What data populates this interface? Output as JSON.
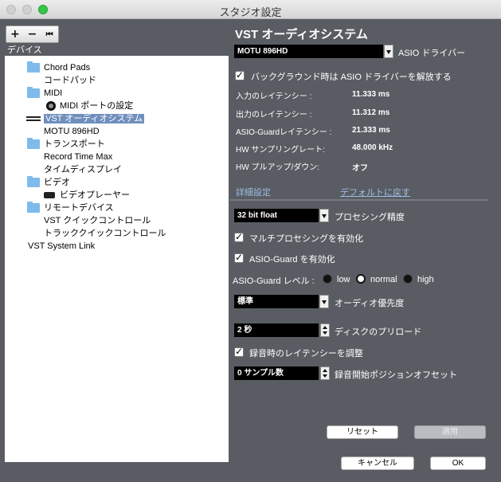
{
  "window": {
    "title": "スタジオ設定"
  },
  "toolbar": {
    "add": "+",
    "remove": "−",
    "reset": "⏮"
  },
  "devices": {
    "header": "デバイス",
    "items": [
      "Chord Pads",
      "コードパッド",
      "MIDI",
      "MIDI ポートの設定",
      "VST オーディオシステム",
      "MOTU 896HD",
      "トランスポート",
      "Record Time Max",
      "タイムディスプレイ",
      "ビデオ",
      "ビデオプレーヤー",
      "リモートデバイス",
      "VST クイックコントロール",
      "トラッククイックコントロール",
      "VST System Link"
    ]
  },
  "panel": {
    "title": "VST オーディオシステム",
    "driver": {
      "value": "MOTU 896HD",
      "label": "ASIO ドライバー"
    },
    "release_driver_label": "バックグラウンド時は ASIO ドライバーを解放する",
    "info": [
      {
        "label": "入力のレイテンシー :",
        "value": "11.333 ms"
      },
      {
        "label": "出力のレイテンシー :",
        "value": "11.312 ms"
      },
      {
        "label": "ASIO-Guardレイテンシー :",
        "value": "21.333 ms"
      },
      {
        "label": "HW サンプリングレート:",
        "value": "48.000 kHz"
      },
      {
        "label": "HW プルアップ/ダウン:",
        "value": "オフ"
      }
    ],
    "advanced_label": "詳細設定",
    "defaults_link": "デフォルトに戻す",
    "precision": {
      "value": "32 bit float",
      "label": "プロセシング精度"
    },
    "multiprocessing_label": "マルチプロセシングを有効化",
    "asio_guard_label": "ASIO-Guard を有効化",
    "asio_guard_level": {
      "label": "ASIO-Guard レベル :",
      "options": [
        "low",
        "normal",
        "high"
      ],
      "selected": "normal"
    },
    "audio_priority": {
      "value": "標準",
      "label": "オーディオ優先度"
    },
    "disk_preload": {
      "value": "2 秒",
      "label": "ディスクのプリロード"
    },
    "adjust_latency_label": "録音時のレイテンシーを調整",
    "record_offset": {
      "value": "0 サンプル数",
      "label": "録音開始ポジションオフセット"
    },
    "reset_button": "リセット",
    "apply_button": "適用"
  },
  "footer": {
    "cancel": "キャンセル",
    "ok": "OK"
  }
}
